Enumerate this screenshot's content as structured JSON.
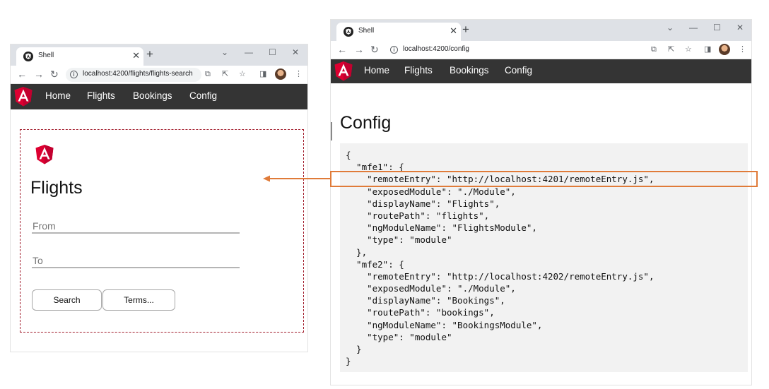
{
  "colors": {
    "angular_red": "#dd0031",
    "appbar_bg": "#343434",
    "highlight_orange": "#e07b39",
    "mfe_border": "#a11a2a",
    "code_bg": "#f2f2f2"
  },
  "left_window": {
    "tab_title": "Shell",
    "url": "localhost:4200/flights/flights-search",
    "nav": [
      "Home",
      "Flights",
      "Bookings",
      "Config"
    ],
    "mfe": {
      "title": "Flights",
      "from_placeholder": "From",
      "to_placeholder": "To",
      "search_label": "Search",
      "terms_label": "Terms..."
    }
  },
  "right_window": {
    "tab_title": "Shell",
    "url": "localhost:4200/config",
    "nav": [
      "Home",
      "Flights",
      "Bookings",
      "Config"
    ],
    "page_title": "Config",
    "code_lines": [
      "{",
      "  \"mfe1\": {",
      "    \"remoteEntry\": \"http://localhost:4201/remoteEntry.js\",",
      "    \"exposedModule\": \"./Module\",",
      "    \"displayName\": \"Flights\",",
      "    \"routePath\": \"flights\",",
      "    \"ngModuleName\": \"FlightsModule\",",
      "    \"type\": \"module\"",
      "  },",
      "  \"mfe2\": {",
      "    \"remoteEntry\": \"http://localhost:4202/remoteEntry.js\",",
      "    \"exposedModule\": \"./Module\",",
      "    \"displayName\": \"Bookings\",",
      "    \"routePath\": \"bookings\",",
      "    \"ngModuleName\": \"BookingsModule\",",
      "    \"type\": \"module\"",
      "  }",
      "}"
    ]
  },
  "icons": {
    "back": "arrow-left-icon",
    "forward": "arrow-right-icon",
    "reload": "reload-icon",
    "info": "info-icon",
    "translate": "translate-icon",
    "share": "share-icon",
    "star": "star-icon",
    "sidepanel": "side-panel-icon",
    "menu": "kebab-menu-icon",
    "minimize": "minimize-icon",
    "maximize": "maximize-icon",
    "close": "close-icon",
    "tabsearch": "chevron-down-icon",
    "logo": "angular-logo-icon"
  }
}
